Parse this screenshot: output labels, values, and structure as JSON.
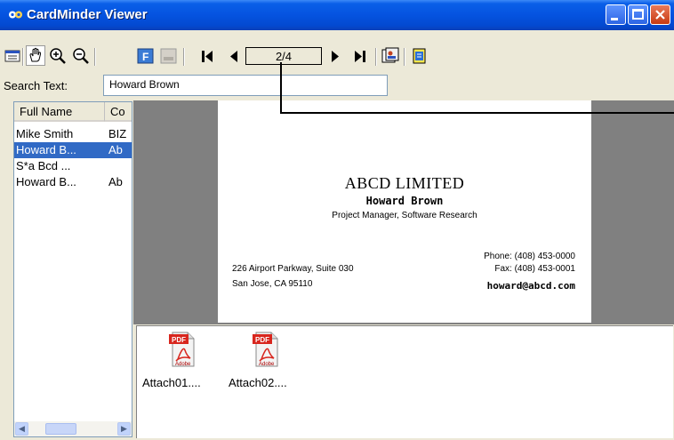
{
  "window": {
    "title": "CardMinder Viewer",
    "buttons": [
      "minimize",
      "maximize",
      "close"
    ]
  },
  "toolbar": {
    "page_indicator": "2/4",
    "icons": [
      "list-view-icon",
      "hand-icon",
      "zoom-in-icon",
      "zoom-out-icon",
      "front-side-icon",
      "back-side-icon",
      "first-page-icon",
      "prev-page-icon",
      "next-page-icon",
      "last-page-icon",
      "card-info-icon",
      "scan-icon"
    ]
  },
  "search": {
    "label": "Search Text:",
    "value": "Howard Brown"
  },
  "list": {
    "columns": [
      "Full Name",
      "Co"
    ],
    "rows": [
      {
        "name": "Mike Smith",
        "company": "BIZ"
      },
      {
        "name": "Howard B...",
        "company": "Ab"
      },
      {
        "name": "S*a Bcd ...",
        "company": ""
      },
      {
        "name": "Howard B...",
        "company": "Ab"
      }
    ],
    "selected_index": 1
  },
  "card": {
    "company": "ABCD LIMITED",
    "name": "Howard Brown",
    "role": "Project Manager, Software Research",
    "address1": "226 Airport Parkway, Suite 030",
    "address2": "San Jose, CA 95110",
    "phone": "Phone: (408) 453-0000",
    "fax": "Fax: (408) 453-0001",
    "email": "howard@abcd.com"
  },
  "attachments": [
    {
      "label": "Attach01....",
      "icon": "pdf-icon",
      "badge": "PDF",
      "brand": "Adobe"
    },
    {
      "label": "Attach02....",
      "icon": "pdf-icon",
      "badge": "PDF",
      "brand": "Adobe"
    }
  ],
  "colors": {
    "titlebar": "#0553e0",
    "selection": "#316ac5",
    "viewer_bg": "#808080",
    "chrome": "#ece9d8"
  }
}
